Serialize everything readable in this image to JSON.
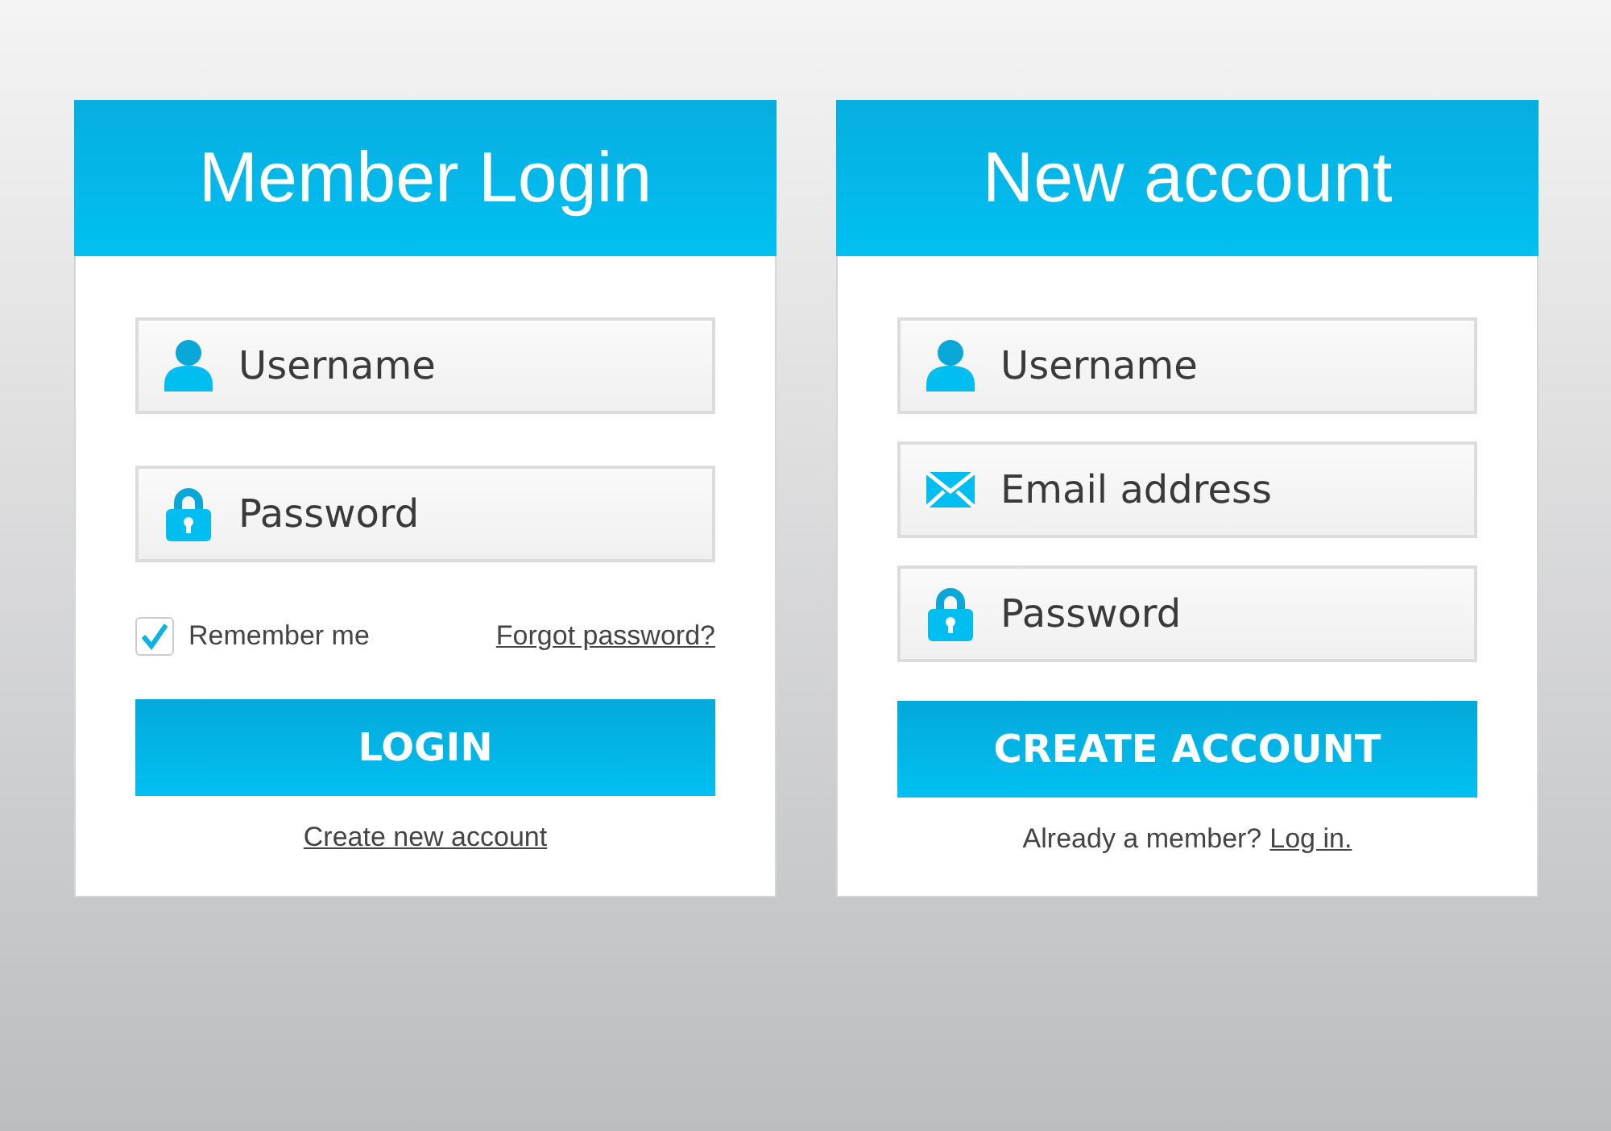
{
  "panels": [
    {
      "title": "Member Login",
      "fields": [
        {
          "kind": "user",
          "placeholder": "Username"
        },
        {
          "kind": "lock",
          "placeholder": "Password"
        }
      ],
      "remember": {
        "label": "Remember me",
        "checked": true
      },
      "forgot_link": "Forgot password?",
      "button": "LOGIN",
      "footer": {
        "link": "Create new account"
      }
    },
    {
      "title": "New account",
      "fields": [
        {
          "kind": "user",
          "placeholder": "Username"
        },
        {
          "kind": "mail",
          "placeholder": "Email address"
        },
        {
          "kind": "lock",
          "placeholder": "Password"
        }
      ],
      "button": "CREATE ACCOUNT",
      "footer": {
        "text": "Already a member?",
        "link": "Log in."
      }
    }
  ]
}
